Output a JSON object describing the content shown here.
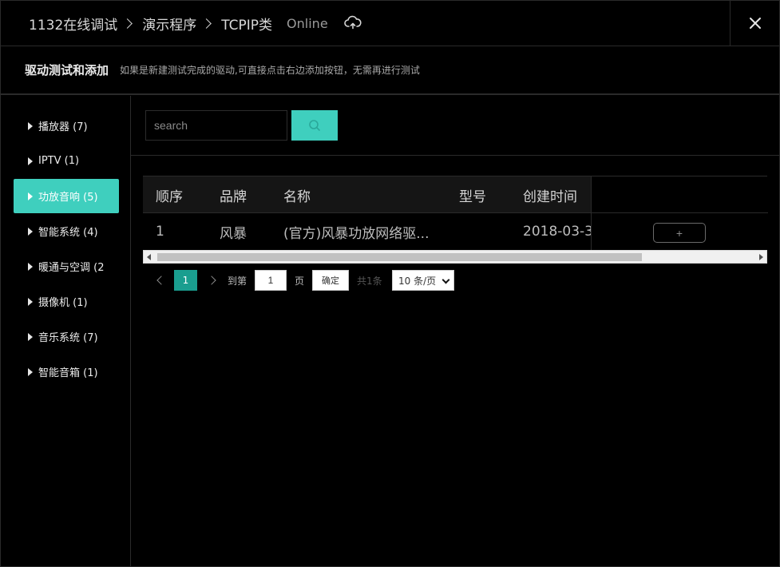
{
  "header": {
    "breadcrumbs": [
      "1132在线调试",
      "演示程序",
      "TCPIP类"
    ],
    "status": "Online",
    "cloud_icon": "cloud-sync-icon",
    "close_icon": "close-icon"
  },
  "subheader": {
    "title": "驱动测试和添加",
    "description": "如果是新建测试完成的驱动,可直接点击右边添加按钮，无需再进行测试"
  },
  "sidebar": {
    "active_index": 2,
    "items": [
      {
        "label": "播放器 (7)"
      },
      {
        "label": "IPTV (1)"
      },
      {
        "label": "功放音响 (5)"
      },
      {
        "label": "智能系统 (4)"
      },
      {
        "label": "暖通与空调 (2"
      },
      {
        "label": "摄像机 (1)"
      },
      {
        "label": "音乐系统 (7)"
      },
      {
        "label": "智能音箱 (1)"
      }
    ]
  },
  "search": {
    "placeholder": "search",
    "button_icon": "search-icon",
    "accent_color": "#3fcfbe"
  },
  "table": {
    "columns": [
      "顺序",
      "品牌",
      "名称",
      "型号",
      "创建时间"
    ],
    "rows": [
      {
        "order": "1",
        "brand": "风暴",
        "name": "(官方)风暴功放网络驱...",
        "model": "",
        "created": "2018-03-3",
        "action": "+"
      }
    ]
  },
  "pagination": {
    "current_page": "1",
    "goto_label": "到第",
    "goto_value": "1",
    "page_label": "页",
    "confirm_label": "确定",
    "total_label": "共1条",
    "page_size": "10 条/页"
  }
}
